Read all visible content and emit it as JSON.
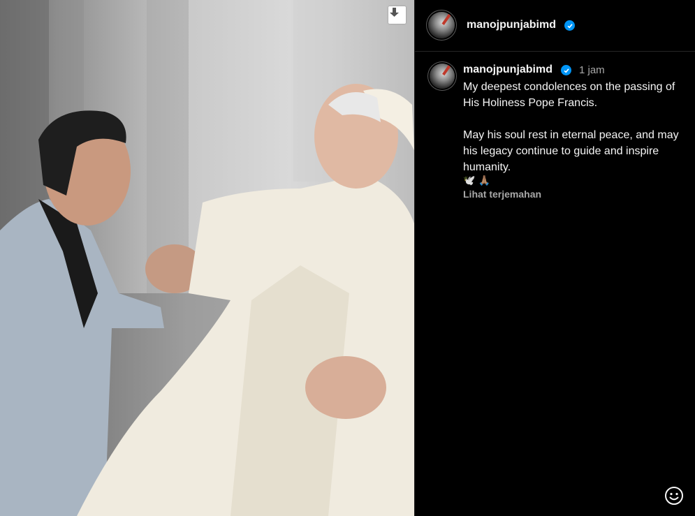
{
  "post": {
    "image_alt": "photo",
    "download_icon": "download-icon"
  },
  "header": {
    "username": "manojpunjabimd"
  },
  "comment": {
    "username": "manojpunjabimd",
    "time": "1 jam",
    "line1": "My deepest condolences on the passing of His Holiness Pope Francis.",
    "line2": "May his soul rest in eternal peace, and may his legacy continue to guide and inspire humanity.",
    "emoji_1": "🕊️",
    "emoji_2": "🙏🏽",
    "translate_label": "Lihat terjemahan"
  },
  "colors": {
    "verified": "#0095f6",
    "secondary_text": "#a8a8a8",
    "background": "#000000"
  }
}
